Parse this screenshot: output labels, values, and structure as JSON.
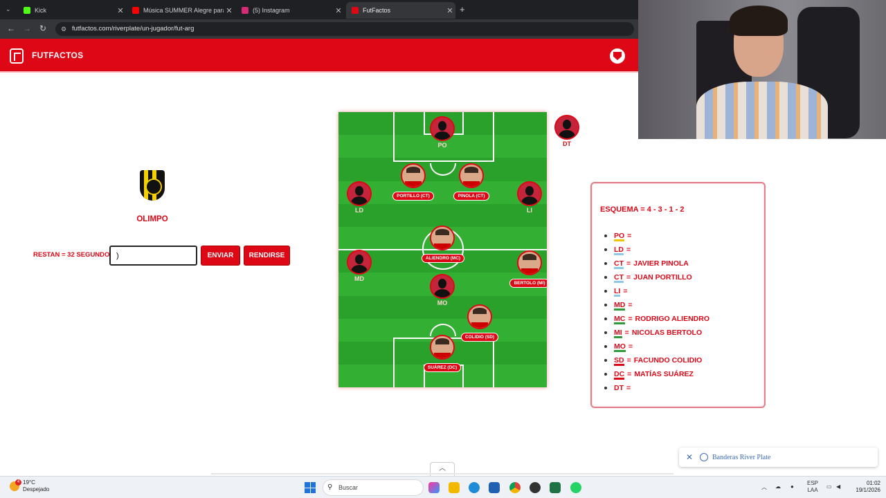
{
  "browser": {
    "tabs": [
      {
        "title": "Kick",
        "favicon_color": "#53fc18",
        "active": false
      },
      {
        "title": "Música SUMMER Alegre para T",
        "favicon_color": "#ff0000",
        "active": false
      },
      {
        "title": "(5) Instagram",
        "favicon_color": "#d62976",
        "active": false
      },
      {
        "title": "FutFactos",
        "favicon_color": "#de0716",
        "active": true
      }
    ],
    "url": "futfactos.com/riverplate/un-jugador/fut-arg",
    "new_tab": "+"
  },
  "site": {
    "brand": "FUTFACTOS",
    "accent_color": "#de0716",
    "crest_icon": "river-plate-crest"
  },
  "team": {
    "name": "OLIMPO",
    "shield_colors": [
      "#111111",
      "#f5d000"
    ]
  },
  "game": {
    "timer": "RESTAN = 32 SEGUNDOS",
    "input_value": ")",
    "submit_label": "ENVIAR",
    "giveup_label": "RENDIRSE"
  },
  "pitch": {
    "players": [
      {
        "key": "po",
        "pos": "PO",
        "name": "",
        "filled": false
      },
      {
        "key": "ld",
        "pos": "LD",
        "name": "",
        "filled": false
      },
      {
        "key": "ct1",
        "pos": "",
        "name": "PORTILLO (CT)",
        "filled": true
      },
      {
        "key": "ct2",
        "pos": "",
        "name": "PINOLA (CT)",
        "filled": true
      },
      {
        "key": "li",
        "pos": "LI",
        "name": "",
        "filled": false
      },
      {
        "key": "mc",
        "pos": "",
        "name": "ALIENDRO (MC)",
        "filled": true
      },
      {
        "key": "md",
        "pos": "MD",
        "name": "",
        "filled": false
      },
      {
        "key": "mi",
        "pos": "",
        "name": "BERTOLO (MI)",
        "filled": true
      },
      {
        "key": "mo",
        "pos": "MO",
        "name": "",
        "filled": false
      },
      {
        "key": "sd",
        "pos": "",
        "name": "COLIDIO (SD)",
        "filled": true
      },
      {
        "key": "dc",
        "pos": "",
        "name": "SUÁREZ (DC)",
        "filled": true
      }
    ],
    "coach": {
      "pos": "DT",
      "filled": false
    }
  },
  "scheme": {
    "title": "ESQUEMA = 4 - 3 - 1 - 2",
    "rows": [
      {
        "code": "PO",
        "name": "",
        "underline": "#f0c400"
      },
      {
        "code": "LD",
        "name": "",
        "underline": "#8ec9ea"
      },
      {
        "code": "CT",
        "name": "JAVIER PINOLA",
        "underline": "#8ec9ea"
      },
      {
        "code": "CT",
        "name": "JUAN PORTILLO",
        "underline": "#8ec9ea"
      },
      {
        "code": "LI",
        "name": "",
        "underline": "#8ec9ea"
      },
      {
        "code": "MD",
        "name": "",
        "underline": "#2e9a3a"
      },
      {
        "code": "MC",
        "name": "RODRIGO ALIENDRO",
        "underline": "#2e9a3a"
      },
      {
        "code": "MI",
        "name": "NICOLAS BERTOLO",
        "underline": "#2e9a3a"
      },
      {
        "code": "MO",
        "name": "",
        "underline": "#2e9a3a"
      },
      {
        "code": "SD",
        "name": "FACUNDO COLIDIO",
        "underline": "#de0716"
      },
      {
        "code": "DC",
        "name": "MATÍAS SUÁREZ",
        "underline": "#de0716"
      },
      {
        "code": "DT",
        "name": "",
        "underline": "#ffffff"
      }
    ]
  },
  "toast": {
    "label": "Banderas River Plate",
    "close": "✕"
  },
  "taskbar": {
    "weather_temp": "19°C",
    "weather_desc": "Despejado",
    "weather_badge": "4",
    "search_placeholder": "Buscar",
    "lang_top": "ESP",
    "lang_bottom": "LAA",
    "time": "01:02",
    "date": "19/1/2026"
  }
}
